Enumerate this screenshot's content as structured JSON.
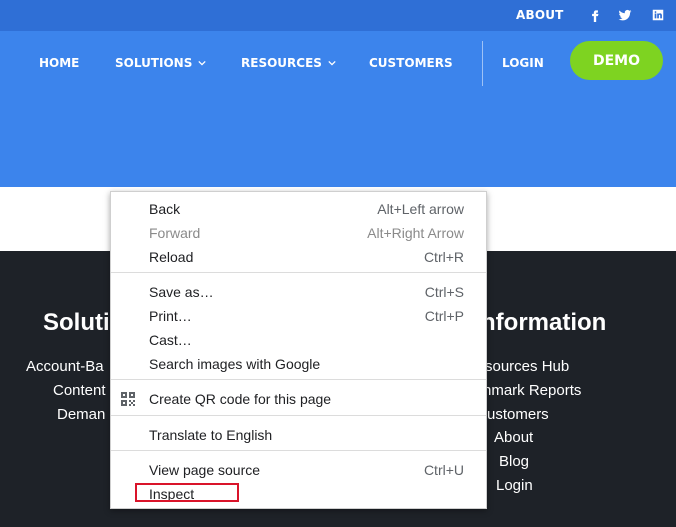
{
  "topbar": {
    "about_label": "ABOUT"
  },
  "nav": {
    "home": "HOME",
    "solutions": "SOLUTIONS",
    "resources": "RESOURCES",
    "customers": "CUSTOMERS",
    "login": "LOGIN",
    "demo": "DEMO"
  },
  "footer": {
    "solutions_heading": "Soluti",
    "solutions_links": [
      "Account-Ba",
      "Content",
      "Deman"
    ],
    "info_heading": "nformation",
    "info_links": [
      "sources Hub",
      "nmark Reports",
      "ustomers",
      "About",
      "Blog",
      "Login"
    ]
  },
  "context_menu": {
    "back": "Back",
    "back_sc": "Alt+Left arrow",
    "forward": "Forward",
    "forward_sc": "Alt+Right Arrow",
    "reload": "Reload",
    "reload_sc": "Ctrl+R",
    "save": "Save as…",
    "save_sc": "Ctrl+S",
    "print": "Print…",
    "print_sc": "Ctrl+P",
    "cast": "Cast…",
    "search_images": "Search images with Google",
    "qr": "Create QR code for this page",
    "translate": "Translate to English",
    "view_source": "View page source",
    "view_source_sc": "Ctrl+U",
    "inspect": "Inspect"
  },
  "colors": {
    "topbar": "#2f6fd6",
    "navbar": "#3c84ec",
    "demo_button": "#7ed321",
    "footer": "#1e2228",
    "highlight_box": "#d9142a"
  },
  "icons": [
    "facebook-icon",
    "twitter-icon",
    "linkedin-icon",
    "chevron-down-icon",
    "qr-code-icon"
  ]
}
